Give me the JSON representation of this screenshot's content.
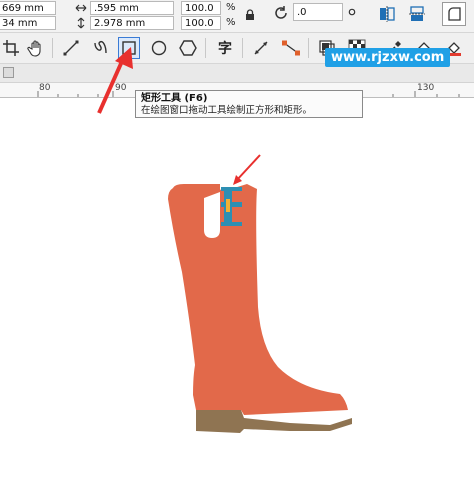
{
  "property_bar": {
    "x_value": "669 mm",
    "y_value": "34 mm",
    "width_value": ".595 mm",
    "height_value": "2.978 mm",
    "scale_x": "100.0",
    "scale_y": "100.0",
    "percent": "%",
    "rotation_value": ".0"
  },
  "toolbar": {
    "text_tool_glyph": "字",
    "rect_tool_tooltip_title": "矩形工具 (F6)",
    "rect_tool_tooltip_desc": "在绘图窗口拖动工具绘制正方形和矩形。"
  },
  "ruler": {
    "labels": [
      "80",
      "90",
      "130"
    ]
  },
  "watermark": "www.rjzxw.com",
  "colors": {
    "boot": "#e2694a",
    "sole": "#8f7452",
    "accent_arrow": "#e8302e",
    "selection_handle": "#2d8fb3"
  }
}
